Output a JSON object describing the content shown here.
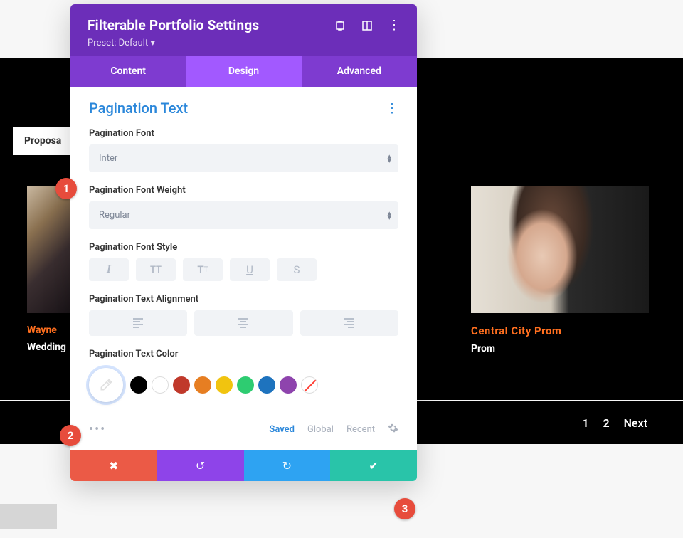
{
  "modal": {
    "title": "Filterable Portfolio Settings",
    "preset": "Preset: Default",
    "tabs": {
      "content": "Content",
      "design": "Design",
      "advanced": "Advanced"
    },
    "section": "Pagination Text",
    "font_label": "Pagination Font",
    "font_value": "Inter",
    "weight_label": "Pagination Font Weight",
    "weight_value": "Regular",
    "style_label": "Pagination Font Style",
    "align_label": "Pagination Text Alignment",
    "color_label": "Pagination Text Color",
    "color_tabs": {
      "saved": "Saved",
      "global": "Global",
      "recent": "Recent"
    },
    "swatches": [
      "#000000",
      "#ffffff",
      "#c0392b",
      "#e67e22",
      "#f1c40f",
      "#2ecc71",
      "#1e73be",
      "#8e44ad"
    ]
  },
  "background": {
    "filter_tab": "Proposa",
    "left_item": {
      "title": "Wayne",
      "category": "Wedding"
    },
    "right_item": {
      "title": "Central City Prom",
      "category": "Prom"
    },
    "pagination": {
      "p1": "1",
      "p2": "2",
      "next": "Next"
    }
  },
  "badges": {
    "b1": "1",
    "b2": "2",
    "b3": "3"
  }
}
